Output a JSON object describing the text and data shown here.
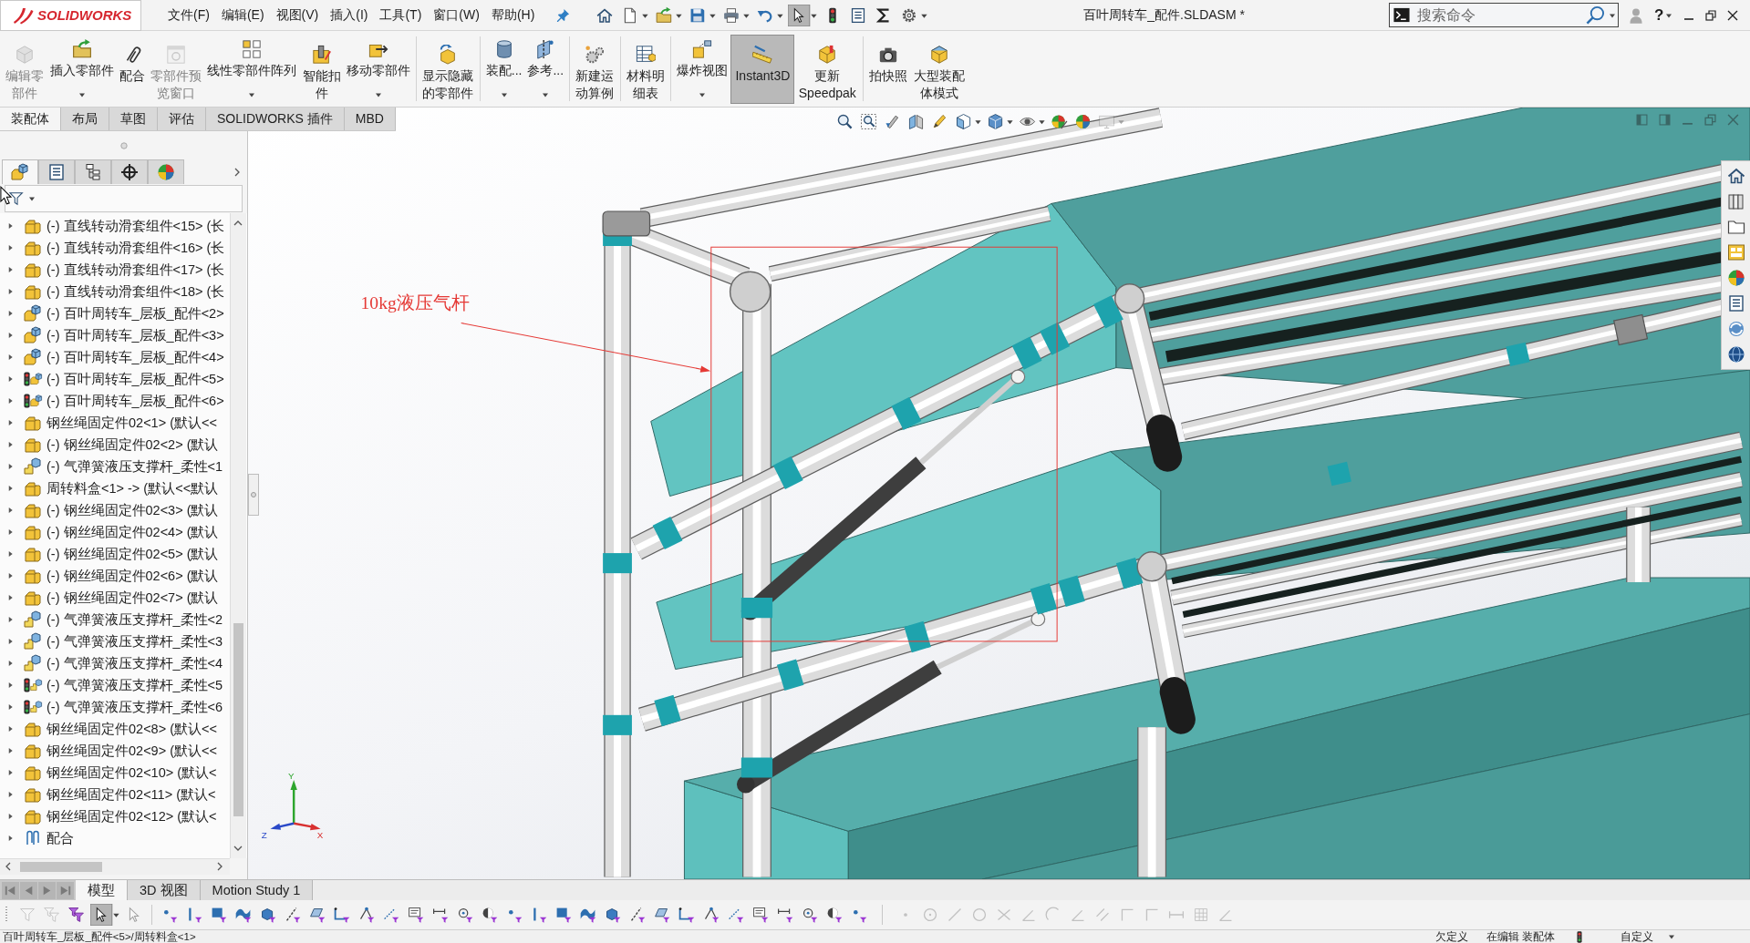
{
  "logo": {
    "text": "SOLIDWORKS"
  },
  "menu": [
    "文件(F)",
    "编辑(E)",
    "视图(V)",
    "插入(I)",
    "工具(T)",
    "窗口(W)",
    "帮助(H)"
  ],
  "quick_access": [
    {
      "dropdown": false,
      "selected": false
    },
    {
      "dropdown": true,
      "selected": false
    },
    {
      "dropdown": true,
      "selected": false
    },
    {
      "dropdown": true,
      "selected": false
    },
    {
      "dropdown": true,
      "selected": false
    },
    {
      "dropdown": true,
      "selected": false
    },
    {
      "dropdown": true,
      "selected": true
    },
    {
      "dropdown": false,
      "selected": false
    },
    {
      "dropdown": false,
      "selected": false
    },
    {
      "dropdown": false,
      "selected": false
    },
    {
      "dropdown": true,
      "selected": false
    }
  ],
  "window": {
    "title": "百叶周转车_配件.SLDASM *"
  },
  "search": {
    "placeholder": "搜索命令"
  },
  "help": {
    "label": "?"
  },
  "ribbon": {
    "groups": [
      [
        {
          "label": "编辑零部件",
          "disabled": true,
          "dropdown": false,
          "selected": false
        },
        {
          "label": "插入零部件",
          "disabled": false,
          "dropdown": true,
          "selected": false
        },
        {
          "label": "配合",
          "disabled": false,
          "dropdown": false,
          "selected": false
        },
        {
          "label": "零部件预览窗口",
          "disabled": true,
          "dropdown": false,
          "selected": false
        },
        {
          "label": "线性零部件阵列",
          "disabled": false,
          "dropdown": true,
          "selected": false
        },
        {
          "label": "智能扣件",
          "disabled": false,
          "dropdown": false,
          "selected": false
        },
        {
          "label": "移动零部件",
          "disabled": false,
          "dropdown": true,
          "selected": false
        }
      ],
      [
        {
          "label": "显示隐藏的零部件",
          "disabled": false,
          "dropdown": false,
          "selected": false
        }
      ],
      [
        {
          "label": "装配...",
          "disabled": false,
          "dropdown": true,
          "selected": false
        },
        {
          "label": "参考...",
          "disabled": false,
          "dropdown": true,
          "selected": false
        }
      ],
      [
        {
          "label": "新建运动算例",
          "disabled": false,
          "dropdown": false,
          "selected": false
        }
      ],
      [
        {
          "label": "材料明细表",
          "disabled": false,
          "dropdown": false,
          "selected": false
        }
      ],
      [
        {
          "label": "爆炸视图",
          "disabled": false,
          "dropdown": true,
          "selected": false
        },
        {
          "label": "Instant3D",
          "disabled": false,
          "dropdown": false,
          "selected": true
        },
        {
          "label": "更新Speedpak",
          "disabled": false,
          "dropdown": false,
          "selected": false
        }
      ],
      [
        {
          "label": "拍快照",
          "disabled": false,
          "dropdown": false,
          "selected": false
        },
        {
          "label": "大型装配体模式",
          "disabled": false,
          "dropdown": false,
          "selected": false
        }
      ]
    ]
  },
  "command_tabs": [
    {
      "label": "装配体",
      "selected": true
    },
    {
      "label": "布局",
      "selected": false
    },
    {
      "label": "草图",
      "selected": false
    },
    {
      "label": "评估",
      "selected": false
    },
    {
      "label": "SOLIDWORKS 插件",
      "selected": false
    },
    {
      "label": "MBD",
      "selected": false
    }
  ],
  "panel_tabs": [
    {
      "selected": true
    },
    {
      "selected": false
    },
    {
      "selected": false
    },
    {
      "selected": false
    },
    {
      "selected": false
    }
  ],
  "tree": {
    "items": [
      {
        "label": "(-) 直线转动滑套组件<15> (长",
        "kind": "part",
        "status_light": false
      },
      {
        "label": "(-) 直线转动滑套组件<16> (长",
        "kind": "part",
        "status_light": false
      },
      {
        "label": "(-) 直线转动滑套组件<17> (长",
        "kind": "part",
        "status_light": false
      },
      {
        "label": "(-) 直线转动滑套组件<18> (长",
        "kind": "part",
        "status_light": false
      },
      {
        "label": "(-) 百叶周转车_层板_配件<2>",
        "kind": "assembly",
        "status_light": false
      },
      {
        "label": "(-) 百叶周转车_层板_配件<3>",
        "kind": "assembly",
        "status_light": false
      },
      {
        "label": "(-) 百叶周转车_层板_配件<4>",
        "kind": "assembly",
        "status_light": false
      },
      {
        "label": "(-) 百叶周转车_层板_配件<5>",
        "kind": "assembly",
        "status_light": true
      },
      {
        "label": "(-) 百叶周转车_层板_配件<6>",
        "kind": "assembly",
        "status_light": true
      },
      {
        "label": "钢丝绳固定件02<1> (默认<<",
        "kind": "part",
        "status_light": false
      },
      {
        "label": "(-) 钢丝绳固定件02<2> (默认",
        "kind": "part",
        "status_light": false
      },
      {
        "label": "(-) 气弹簧液压支撑杆_柔性<1",
        "kind": "flexible",
        "status_light": false
      },
      {
        "label": "周转料盒<1> -> (默认<<默认",
        "kind": "part",
        "status_light": false
      },
      {
        "label": "(-) 钢丝绳固定件02<3> (默认",
        "kind": "part",
        "status_light": false
      },
      {
        "label": "(-) 钢丝绳固定件02<4> (默认",
        "kind": "part",
        "status_light": false
      },
      {
        "label": "(-) 钢丝绳固定件02<5> (默认",
        "kind": "part",
        "status_light": false
      },
      {
        "label": "(-) 钢丝绳固定件02<6> (默认",
        "kind": "part",
        "status_light": false
      },
      {
        "label": "(-) 钢丝绳固定件02<7> (默认",
        "kind": "part",
        "status_light": false
      },
      {
        "label": "(-) 气弹簧液压支撑杆_柔性<2",
        "kind": "flexible",
        "status_light": false
      },
      {
        "label": "(-) 气弹簧液压支撑杆_柔性<3",
        "kind": "flexible",
        "status_light": false
      },
      {
        "label": "(-) 气弹簧液压支撑杆_柔性<4",
        "kind": "flexible",
        "status_light": false
      },
      {
        "label": "(-) 气弹簧液压支撑杆_柔性<5",
        "kind": "flexible",
        "status_light": true
      },
      {
        "label": "(-) 气弹簧液压支撑杆_柔性<6",
        "kind": "flexible",
        "status_light": true
      },
      {
        "label": "钢丝绳固定件02<8> (默认<<",
        "kind": "part",
        "status_light": false
      },
      {
        "label": "钢丝绳固定件02<9> (默认<<",
        "kind": "part",
        "status_light": false
      },
      {
        "label": "钢丝绳固定件02<10> (默认<",
        "kind": "part",
        "status_light": false
      },
      {
        "label": "钢丝绳固定件02<11> (默认<",
        "kind": "part",
        "status_light": false
      },
      {
        "label": "钢丝绳固定件02<12> (默认<",
        "kind": "part",
        "status_light": false
      },
      {
        "label": "配合",
        "kind": "mates",
        "status_light": false
      }
    ]
  },
  "viewport": {
    "heads_up_toolbar": [
      {
        "dropdown": false,
        "disabled": false
      },
      {
        "dropdown": false,
        "disabled": false
      },
      {
        "dropdown": false,
        "disabled": false
      },
      {
        "dropdown": false,
        "disabled": false
      },
      {
        "dropdown": false,
        "disabled": false
      },
      {
        "dropdown": true,
        "disabled": false
      },
      {
        "dropdown": true,
        "disabled": false
      },
      {
        "dropdown": true,
        "disabled": false
      },
      {
        "dropdown": false,
        "disabled": false
      },
      {
        "dropdown": false,
        "disabled": false
      },
      {
        "dropdown": true,
        "disabled": true
      }
    ],
    "callout": {
      "text": "10kg液压气杆"
    },
    "triad": {
      "x": "X",
      "y": "Y",
      "z": "Z"
    }
  },
  "bottom_tabs": [
    {
      "label": "模型",
      "selected": true
    },
    {
      "label": "3D 视图",
      "selected": false
    },
    {
      "label": "Motion Study 1",
      "selected": false
    }
  ],
  "selection_toolbar": {
    "filters": [
      {
        "selected": false,
        "disabled": true,
        "dropdown": false
      },
      {
        "selected": false,
        "disabled": true,
        "dropdown": false
      },
      {
        "selected": false,
        "disabled": false,
        "dropdown": false
      },
      {
        "selected": true,
        "disabled": false,
        "dropdown": true
      },
      {
        "selected": false,
        "disabled": true,
        "dropdown": false
      },
      {
        "selected": false,
        "disabled": false,
        "dropdown": false
      },
      {
        "selected": false,
        "disabled": false,
        "dropdown": false
      },
      {
        "selected": false,
        "disabled": false,
        "dropdown": false
      },
      {
        "selected": false,
        "disabled": false,
        "dropdown": false
      },
      {
        "selected": false,
        "disabled": false,
        "dropdown": false
      },
      {
        "selected": false,
        "disabled": false,
        "dropdown": false
      },
      {
        "selected": false,
        "disabled": false,
        "dropdown": false
      },
      {
        "selected": false,
        "disabled": false,
        "dropdown": false
      },
      {
        "selected": false,
        "disabled": false,
        "dropdown": false
      },
      {
        "selected": false,
        "disabled": false,
        "dropdown": false
      },
      {
        "selected": false,
        "disabled": false,
        "dropdown": false
      },
      {
        "selected": false,
        "disabled": false,
        "dropdown": false
      },
      {
        "selected": false,
        "disabled": false,
        "dropdown": false
      },
      {
        "selected": false,
        "disabled": false,
        "dropdown": false
      },
      {
        "selected": false,
        "disabled": false,
        "dropdown": false
      },
      {
        "selected": false,
        "disabled": false,
        "dropdown": false
      },
      {
        "selected": false,
        "disabled": false,
        "dropdown": false
      },
      {
        "selected": false,
        "disabled": false,
        "dropdown": false
      },
      {
        "selected": false,
        "disabled": false,
        "dropdown": false
      },
      {
        "selected": false,
        "disabled": false,
        "dropdown": false
      },
      {
        "selected": false,
        "disabled": false,
        "dropdown": false
      },
      {
        "selected": false,
        "disabled": false,
        "dropdown": false
      },
      {
        "selected": false,
        "disabled": false,
        "dropdown": false
      },
      {
        "selected": false,
        "disabled": false,
        "dropdown": false
      },
      {
        "selected": false,
        "disabled": false,
        "dropdown": false
      },
      {
        "selected": false,
        "disabled": false,
        "dropdown": false
      },
      {
        "selected": false,
        "disabled": false,
        "dropdown": false
      },
      {
        "selected": false,
        "disabled": false,
        "dropdown": false
      },
      {
        "selected": false,
        "disabled": false,
        "dropdown": false
      }
    ],
    "sketch_tools": [
      {
        "disabled": true
      },
      {
        "disabled": true
      },
      {
        "disabled": true
      },
      {
        "disabled": true
      },
      {
        "disabled": true
      },
      {
        "disabled": true
      },
      {
        "disabled": true
      },
      {
        "disabled": true
      },
      {
        "disabled": true
      },
      {
        "disabled": true
      },
      {
        "disabled": true
      },
      {
        "disabled": true
      },
      {
        "disabled": true
      },
      {
        "disabled": true
      }
    ]
  },
  "status_bar": {
    "path": "百叶周转车_层板_配件<5>/周转料盒<1>",
    "definition": "欠定义",
    "mode": "在编辑 装配体",
    "units": "自定义"
  }
}
